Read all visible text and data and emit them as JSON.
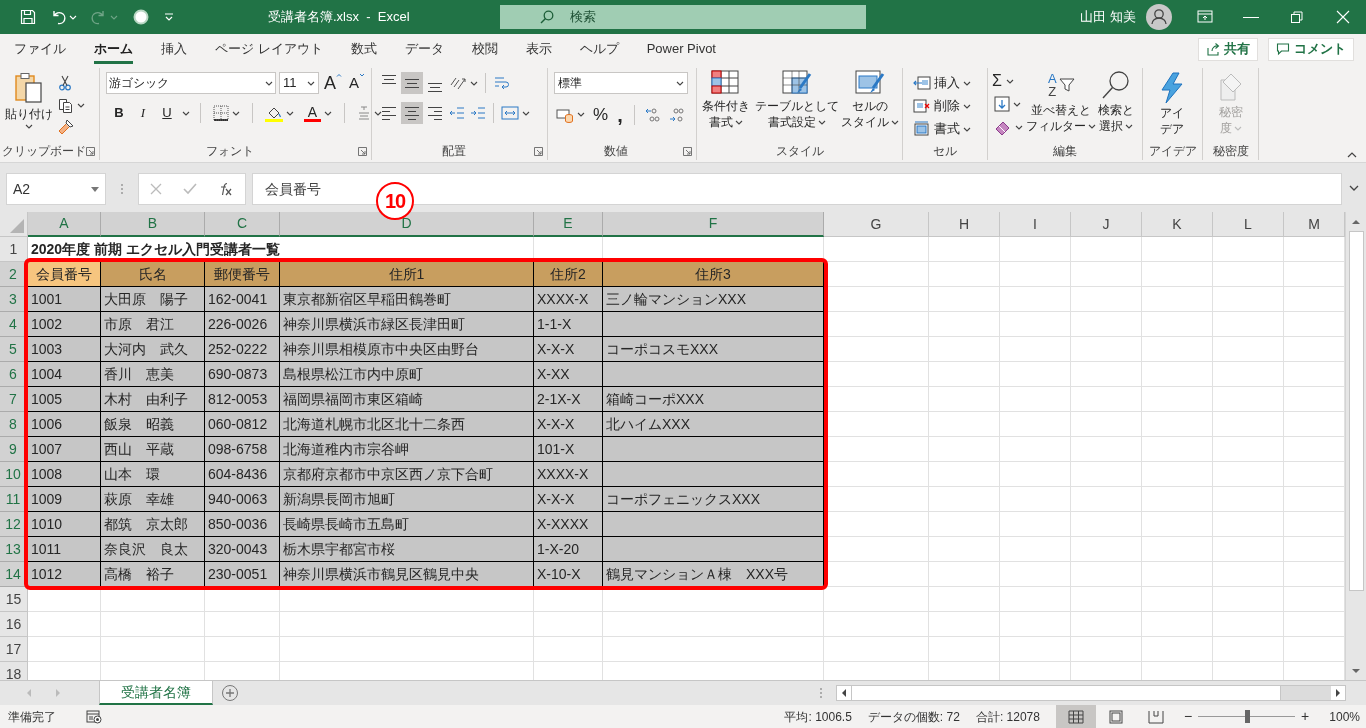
{
  "title_bar": {
    "file_title": "受講者名簿.xlsx  -  Excel",
    "search_placeholder": "検索",
    "user_name": "山田 知美"
  },
  "menu_tabs": [
    {
      "label": "ファイル",
      "selected": false
    },
    {
      "label": "ホーム",
      "selected": true
    },
    {
      "label": "挿入",
      "selected": false
    },
    {
      "label": "ページ レイアウト",
      "selected": false
    },
    {
      "label": "数式",
      "selected": false
    },
    {
      "label": "データ",
      "selected": false
    },
    {
      "label": "校閲",
      "selected": false
    },
    {
      "label": "表示",
      "selected": false
    },
    {
      "label": "ヘルプ",
      "selected": false
    },
    {
      "label": "Power Pivot",
      "selected": false
    }
  ],
  "share_button": "共有",
  "comment_button": "コメント",
  "ribbon": {
    "clipboard": {
      "paste": "貼り付け",
      "label": "クリップボード"
    },
    "font": {
      "name": "游ゴシック",
      "size": "11",
      "grow": "A",
      "shrink": "A",
      "styles": [
        "B",
        "I",
        "U"
      ],
      "font_color": "A",
      "label": "フォント"
    },
    "alignment": {
      "vertical": [
        {
          "selected": false
        },
        {
          "selected": true
        },
        {
          "selected": false
        }
      ],
      "horizontal": [
        {
          "selected": false
        },
        {
          "selected": true
        },
        {
          "selected": false
        }
      ],
      "label": "配置"
    },
    "number": {
      "format": "標準",
      "percent": "%",
      "comma": ",",
      "label": "数値"
    },
    "styles": {
      "buttons": [
        {
          "lines": [
            "条件付き",
            "書式"
          ]
        },
        {
          "lines": [
            "テーブルとして",
            "書式設定"
          ]
        },
        {
          "lines": [
            "セルの",
            "スタイル"
          ]
        }
      ],
      "label": "スタイル"
    },
    "cells": {
      "buttons": [
        "挿入",
        "削除",
        "書式"
      ],
      "label": "セル"
    },
    "editing": {
      "sum": "Σ",
      "sort_glyphs": [
        "A",
        "Z"
      ],
      "buttons": [
        {
          "lines": [
            "並べ替えと",
            "フィルター"
          ]
        },
        {
          "lines": [
            "検索と",
            "選択"
          ]
        }
      ],
      "label": "編集"
    },
    "ideas": {
      "lines": [
        "アイ",
        "デア"
      ],
      "label": "アイデア"
    },
    "sensitivity": {
      "lines": [
        "秘密",
        "度"
      ],
      "label": "秘密度",
      "disabled": true
    }
  },
  "formula_bar": {
    "name_box": "A2",
    "content": "会員番号"
  },
  "annotation": "10",
  "sheet": {
    "columns": [
      {
        "label": "A",
        "selected": true
      },
      {
        "label": "B",
        "selected": true
      },
      {
        "label": "C",
        "selected": true
      },
      {
        "label": "D",
        "selected": true
      },
      {
        "label": "E",
        "selected": true
      },
      {
        "label": "F",
        "selected": true
      },
      {
        "label": "G",
        "selected": false
      },
      {
        "label": "H",
        "selected": false
      },
      {
        "label": "I",
        "selected": false
      },
      {
        "label": "J",
        "selected": false
      },
      {
        "label": "K",
        "selected": false
      },
      {
        "label": "L",
        "selected": false
      },
      {
        "label": "M",
        "selected": false
      }
    ],
    "row_numbers": [
      {
        "label": "1",
        "selected": false
      },
      {
        "label": "2",
        "selected": true
      },
      {
        "label": "3",
        "selected": true
      },
      {
        "label": "4",
        "selected": true
      },
      {
        "label": "5",
        "selected": true
      },
      {
        "label": "6",
        "selected": true
      },
      {
        "label": "7",
        "selected": true
      },
      {
        "label": "8",
        "selected": true
      },
      {
        "label": "9",
        "selected": true
      },
      {
        "label": "10",
        "selected": true
      },
      {
        "label": "11",
        "selected": true
      },
      {
        "label": "12",
        "selected": true
      },
      {
        "label": "13",
        "selected": true
      },
      {
        "label": "14",
        "selected": true
      },
      {
        "label": "15",
        "selected": false
      },
      {
        "label": "16",
        "selected": false
      },
      {
        "label": "17",
        "selected": false
      },
      {
        "label": "18",
        "selected": false
      }
    ],
    "title": "2020年度 前期 エクセル入門受講者一覧",
    "header": [
      {
        "text": "会員番号",
        "active": true
      },
      {
        "text": "氏名",
        "active": false
      },
      {
        "text": "郵便番号",
        "active": false
      },
      {
        "text": "住所1",
        "active": false
      },
      {
        "text": "住所2",
        "active": false
      },
      {
        "text": "住所3",
        "active": false
      }
    ],
    "rows": [
      [
        "1001",
        "大田原　陽子",
        "162-0041",
        "東京都新宿区早稲田鶴巻町",
        "XXXX-X",
        "三ノ輪マンションXXX"
      ],
      [
        "1002",
        "市原　君江",
        "226-0026",
        "神奈川県横浜市緑区長津田町",
        "1-1-X"
      ],
      [
        "1003",
        "大河内　武久",
        "252-0222",
        "神奈川県相模原市中央区由野台",
        "X-X-X",
        "コーポコスモXXX"
      ],
      [
        "1004",
        "香川　恵美",
        "690-0873",
        "島根県松江市内中原町",
        "X-XX"
      ],
      [
        "1005",
        "木村　由利子",
        "812-0053",
        "福岡県福岡市東区箱崎",
        "2-1X-X",
        "箱崎コーポXXX"
      ],
      [
        "1006",
        "飯泉　昭義",
        "060-0812",
        "北海道札幌市北区北十二条西",
        "X-X-X",
        "北ハイムXXX"
      ],
      [
        "1007",
        "西山　平蔵",
        "098-6758",
        "北海道稚内市宗谷岬",
        "101-X"
      ],
      [
        "1008",
        "山本　環",
        "604-8436",
        "京都府京都市中京区西ノ京下合町",
        "XXXX-X"
      ],
      [
        "1009",
        "萩原　幸雄",
        "940-0063",
        "新潟県長岡市旭町",
        "X-X-X",
        "コーポフェニックスXXX"
      ],
      [
        "1010",
        "都筑　京太郎",
        "850-0036",
        "長崎県長崎市五島町",
        "X-XXXX"
      ],
      [
        "1011",
        "奈良沢　良太",
        "320-0043",
        "栃木県宇都宮市桜",
        "1-X-20"
      ],
      [
        "1012",
        "高橋　裕子",
        "230-0051",
        "神奈川県横浜市鶴見区鶴見中央",
        "X-10-X",
        "鶴見マンションＡ棟　XXX号"
      ]
    ]
  },
  "sheet_tabs": [
    {
      "label": "受講者名簿",
      "selected": true
    }
  ],
  "status_bar": {
    "mode": "準備完了",
    "stats": [
      "平均: 1006.5",
      "データの個数: 72",
      "合計: 12078"
    ],
    "views": [
      {
        "selected": true
      },
      {
        "selected": false
      },
      {
        "selected": false
      }
    ],
    "zoom_out": "−",
    "zoom_in": "+",
    "zoom": {
      "level": 0.5
    },
    "zoom_percent": "100%"
  }
}
